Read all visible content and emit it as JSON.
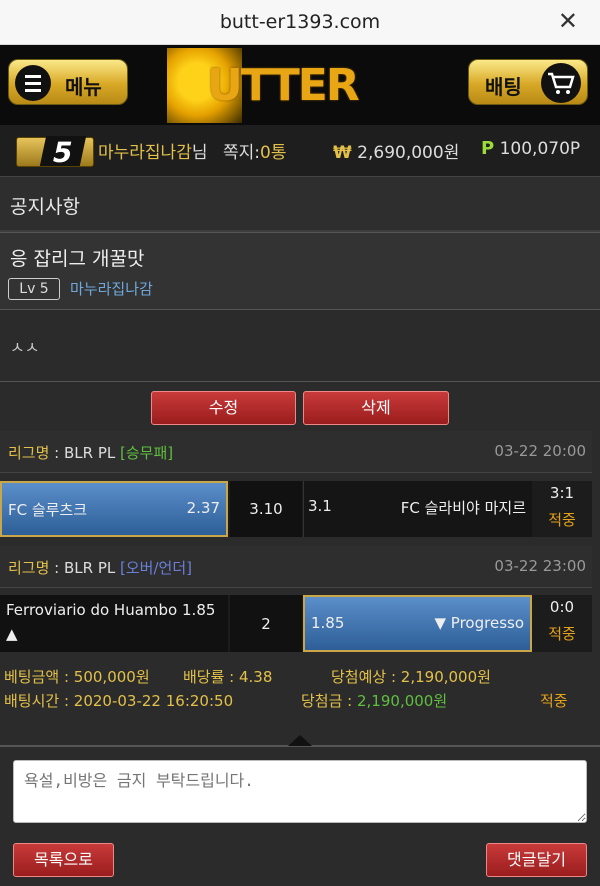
{
  "browser": {
    "url": "butt-er1393.com",
    "close_label": "✕"
  },
  "header": {
    "menu_label": "메뉴",
    "logo_text": "UTTER",
    "bet_label": "배팅"
  },
  "user": {
    "level": "5",
    "name": "마누라집나감",
    "name_suffix": "님",
    "msg_label": "쪽지:",
    "msg_count": "0통",
    "money_symbol": "₩",
    "money": "2,690,000원",
    "point_symbol": "P",
    "point": "100,070P"
  },
  "section": {
    "title": "공지사항"
  },
  "post": {
    "title": "응 잡리그 개꿀맛",
    "level_tag": "Lv 5",
    "author": "마누라집나감",
    "body": "ㅅㅅ",
    "edit_label": "수정",
    "delete_label": "삭제"
  },
  "bets": [
    {
      "league_label": "리그명",
      "league_name": " : BLR PL ",
      "type": "[승무패]",
      "datetime": "03-22 20:00",
      "home": "FC 슬루츠크",
      "home_odds": "2.37",
      "draw_odds": "3.10",
      "away_odds": "3.1",
      "away": "FC 슬라비야 마지르",
      "score": "3:1",
      "status": "적중"
    },
    {
      "league_label": "리그명",
      "league_name": " : BLR PL ",
      "type": "[오버/언더]",
      "datetime": "03-22 23:00",
      "home": "Ferroviario do Huambo",
      "home_odds": "1.85",
      "home_arrow": "▲",
      "line": "2",
      "away_odds": "1.85",
      "away": "▼ Progresso",
      "score": "0:0",
      "status": "적중"
    }
  ],
  "summary": {
    "amount_label": "베팅금액 : ",
    "amount": "500,000원",
    "rate_label": "배당률 : ",
    "rate": "4.38",
    "expected_label": "당첨예상 : ",
    "expected": "2,190,000원",
    "time_label": "배팅시간 : ",
    "time": "2020-03-22 16:20:50",
    "win_label": "당첨금 : ",
    "win": "2,190,000원",
    "status": "적중"
  },
  "comment": {
    "placeholder": "욕설,비방은 금지 부탁드립니다."
  },
  "footer": {
    "list_label": "목록으로",
    "reply_label": "댓글달기"
  }
}
